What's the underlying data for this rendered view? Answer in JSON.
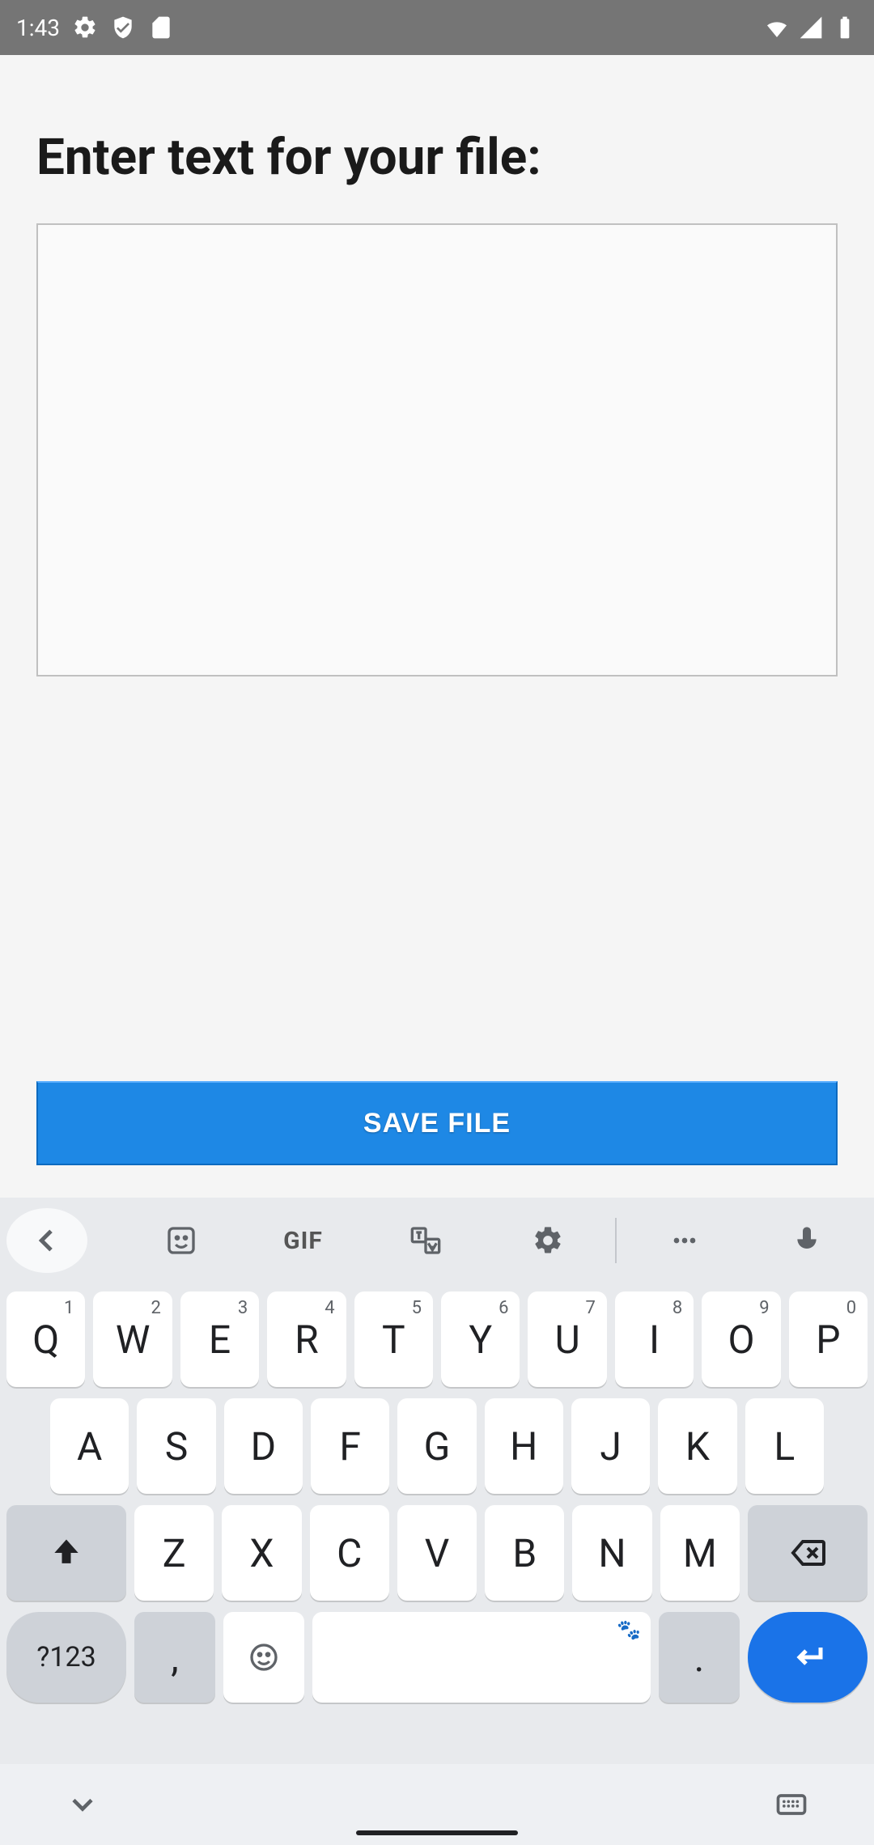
{
  "status": {
    "time": "1:43",
    "icons_left": [
      "gear-icon",
      "shield-icon",
      "sdcard-icon"
    ],
    "icons_right": [
      "wifi-icon",
      "signal-icon",
      "battery-icon"
    ]
  },
  "page": {
    "title": "Enter text for your file:",
    "textarea_value": "",
    "save_label": "SAVE FILE"
  },
  "keyboard": {
    "toolbar": {
      "gif_label": "GIF",
      "items": [
        "back-icon",
        "sticker-icon",
        "gif",
        "translate-icon",
        "gear-icon",
        "more-icon",
        "mic-icon"
      ]
    },
    "rows": [
      {
        "keys": [
          "Q",
          "W",
          "E",
          "R",
          "T",
          "Y",
          "U",
          "I",
          "O",
          "P"
        ],
        "sup": [
          "1",
          "2",
          "3",
          "4",
          "5",
          "6",
          "7",
          "8",
          "9",
          "0"
        ]
      },
      {
        "keys": [
          "A",
          "S",
          "D",
          "F",
          "G",
          "H",
          "J",
          "K",
          "L"
        ]
      },
      {
        "keys": [
          "Z",
          "X",
          "C",
          "V",
          "B",
          "N",
          "M"
        ]
      }
    ],
    "symbols_label": "?123",
    "comma": ",",
    "period": "."
  }
}
